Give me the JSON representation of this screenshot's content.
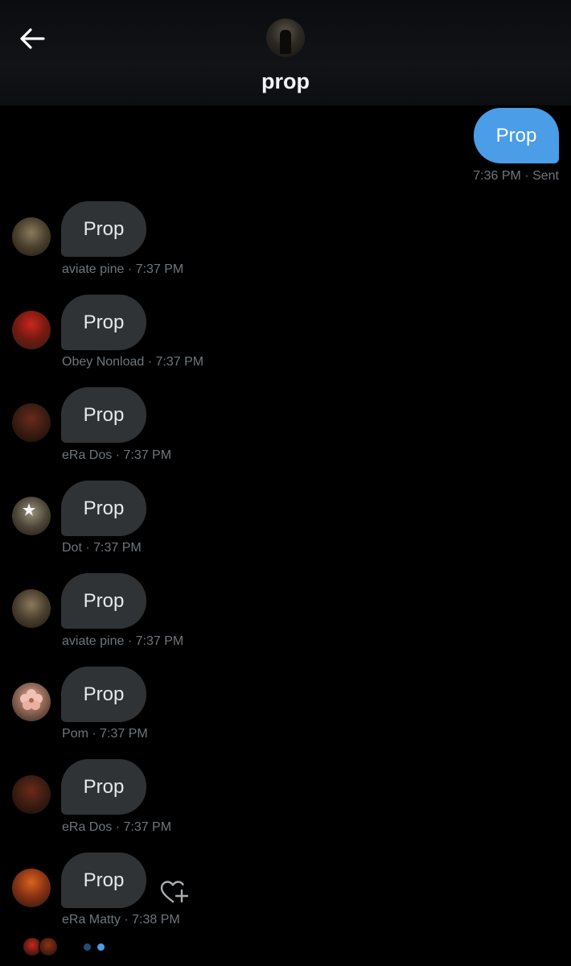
{
  "header": {
    "title": "prop"
  },
  "sent_message": {
    "text": "Prop",
    "meta": "7:36 PM · Sent"
  },
  "messages": [
    {
      "text": "Prop",
      "meta": "aviate pine · 7:37 PM"
    },
    {
      "text": "Prop",
      "meta": "Obey Nonload · 7:37 PM"
    },
    {
      "text": "Prop",
      "meta": "eRa Dos · 7:37 PM"
    },
    {
      "text": "Prop",
      "meta": "Dot · 7:37 PM"
    },
    {
      "text": "Prop",
      "meta": "aviate pine · 7:37 PM"
    },
    {
      "text": "Prop",
      "meta": "Pom · 7:37 PM"
    },
    {
      "text": "Prop",
      "meta": "eRa Dos · 7:37 PM"
    },
    {
      "text": "Prop",
      "meta": "eRa Matty · 7:38 PM"
    }
  ],
  "colors": {
    "sent_bubble": "#4a9de6",
    "received_bubble": "#2f3336",
    "meta_text": "#6f767c",
    "background": "#000000"
  },
  "icons": {
    "back": "arrow-left-icon",
    "react": "heart-plus-icon"
  }
}
